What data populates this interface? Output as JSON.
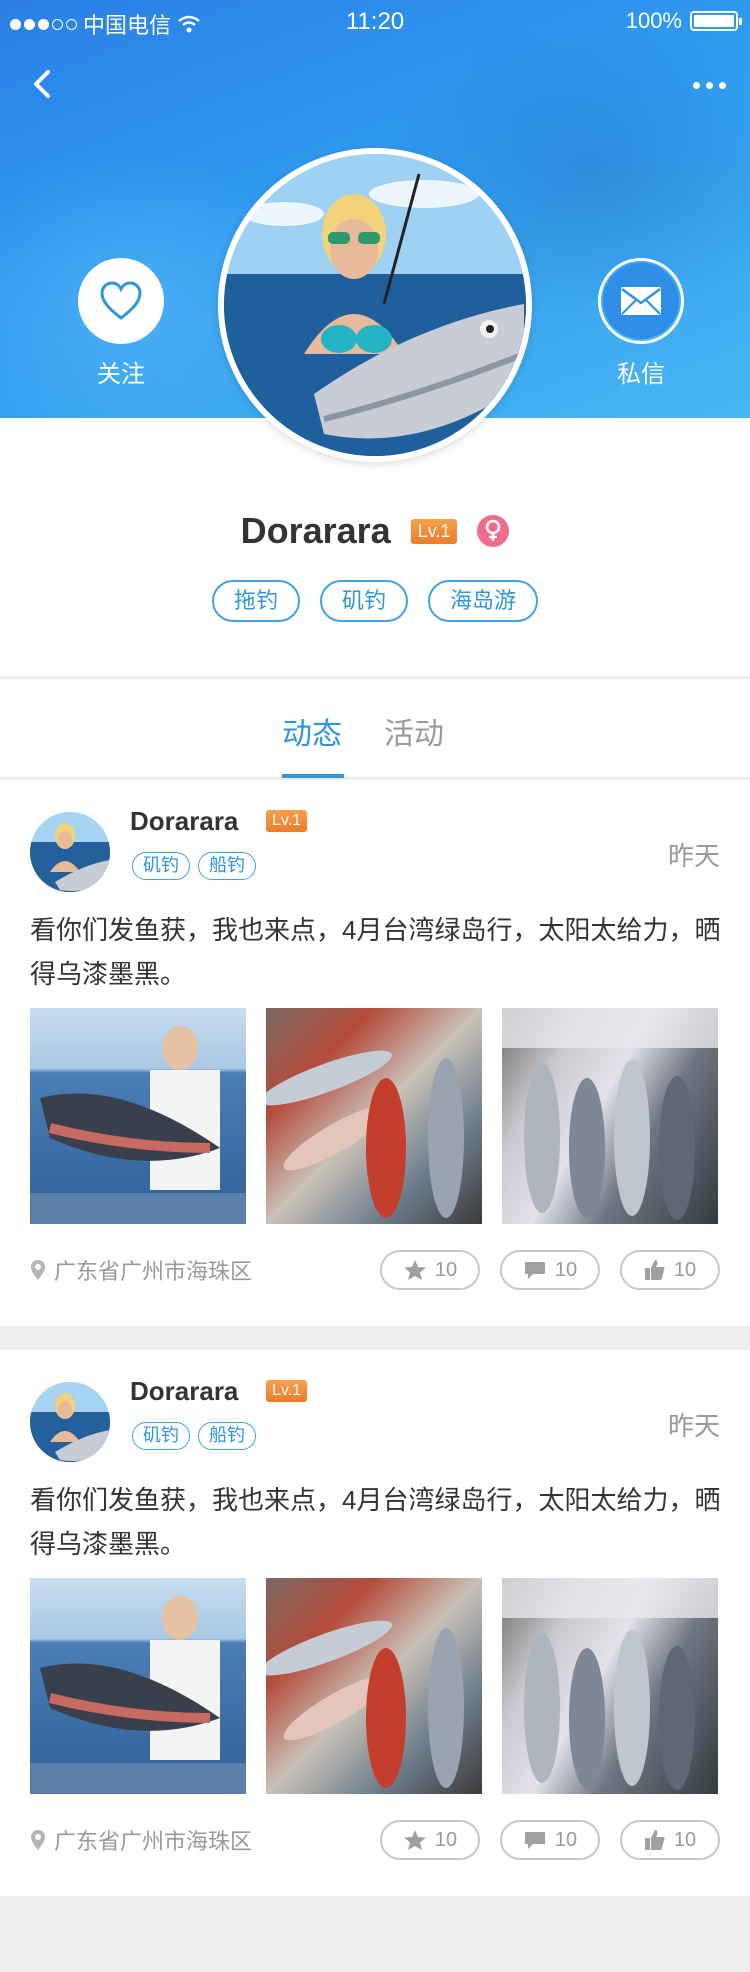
{
  "status_bar": {
    "carrier": "中国电信",
    "time": "11:20",
    "battery": "100%"
  },
  "header": {
    "follow_label": "关注",
    "message_label": "私信"
  },
  "profile": {
    "name": "Dorarara",
    "level": "Lv.1",
    "tags": [
      "拖钓",
      "矶钓",
      "海岛游"
    ]
  },
  "tabs": [
    {
      "label": "动态"
    },
    {
      "label": "活动"
    }
  ],
  "posts": [
    {
      "name": "Dorarara",
      "level": "Lv.1",
      "tags": [
        "矶钓",
        "船钓"
      ],
      "time": "昨天",
      "text": "看你们发鱼获，我也来点，4月台湾绿岛行，太阳太给力，晒得乌漆墨黑。",
      "location": "广东省广州市海珠区",
      "favorites": "10",
      "comments": "10",
      "likes": "10"
    },
    {
      "name": "Dorarara",
      "level": "Lv.1",
      "tags": [
        "矶钓",
        "船钓"
      ],
      "time": "昨天",
      "text": "看你们发鱼获，我也来点，4月台湾绿岛行，太阳太给力，晒得乌漆墨黑。",
      "location": "广东省广州市海珠区",
      "favorites": "10",
      "comments": "10",
      "likes": "10"
    }
  ],
  "colors": {
    "accent": "#2f95dc",
    "level_badge": "#ef7b2c",
    "female": "#f06c8a"
  }
}
